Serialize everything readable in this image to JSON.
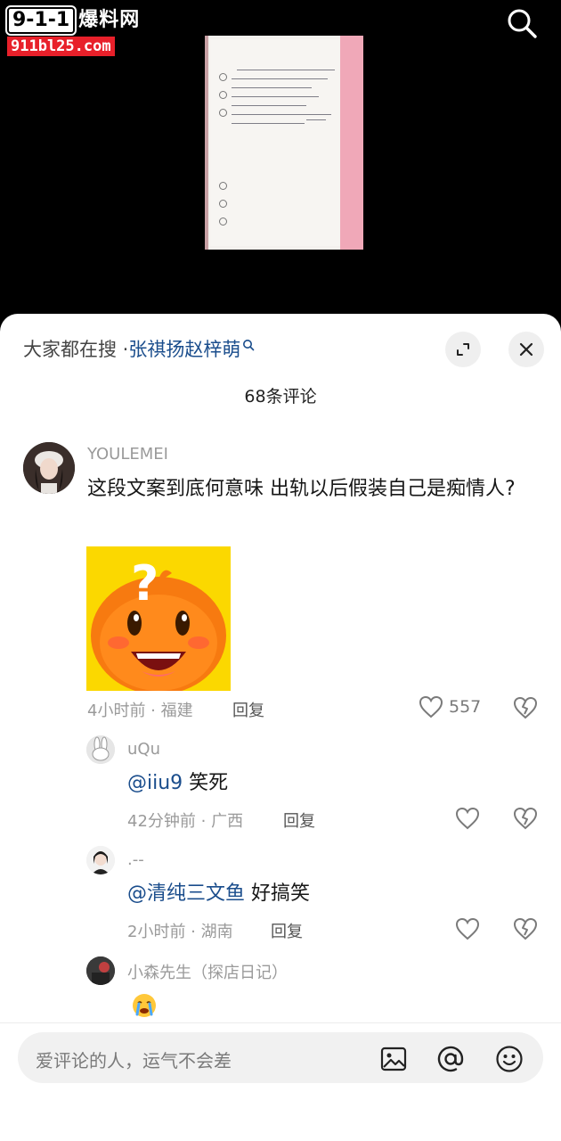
{
  "watermark": {
    "logo_number": "9-1-1",
    "logo_text": "爆料网",
    "domain": "911bl25.com"
  },
  "header": {
    "hot_search_prefix": "大家都在搜 · ",
    "hot_search_keyword": "张祺扬赵梓萌",
    "comment_count_title": "68条评论"
  },
  "comments": [
    {
      "username": "YOULEMEI",
      "text": "这段文案到底何意味 出轨以后假装自己是痴情人?",
      "has_sticker": true,
      "time_location": "4小时前 · 福建",
      "reply_label": "回复",
      "likes": "557",
      "replies": [
        {
          "username": "uQu",
          "mention": "@iiu9",
          "text": " 笑死",
          "time_location": "42分钟前 · 广西",
          "reply_label": "回复"
        },
        {
          "username": ".--",
          "mention": "@清纯三文鱼",
          "text": " 好搞笑",
          "time_location": "2小时前 · 湖南",
          "reply_label": "回复"
        },
        {
          "username": "小森先生（探店日记）",
          "text": "😭"
        }
      ]
    }
  ],
  "input": {
    "placeholder": "爱评论的人，运气不会差"
  },
  "icons": [
    "search-icon",
    "expand-icon",
    "close-icon",
    "heart-icon",
    "broken-heart-icon",
    "image-icon",
    "at-icon",
    "emoji-icon"
  ]
}
